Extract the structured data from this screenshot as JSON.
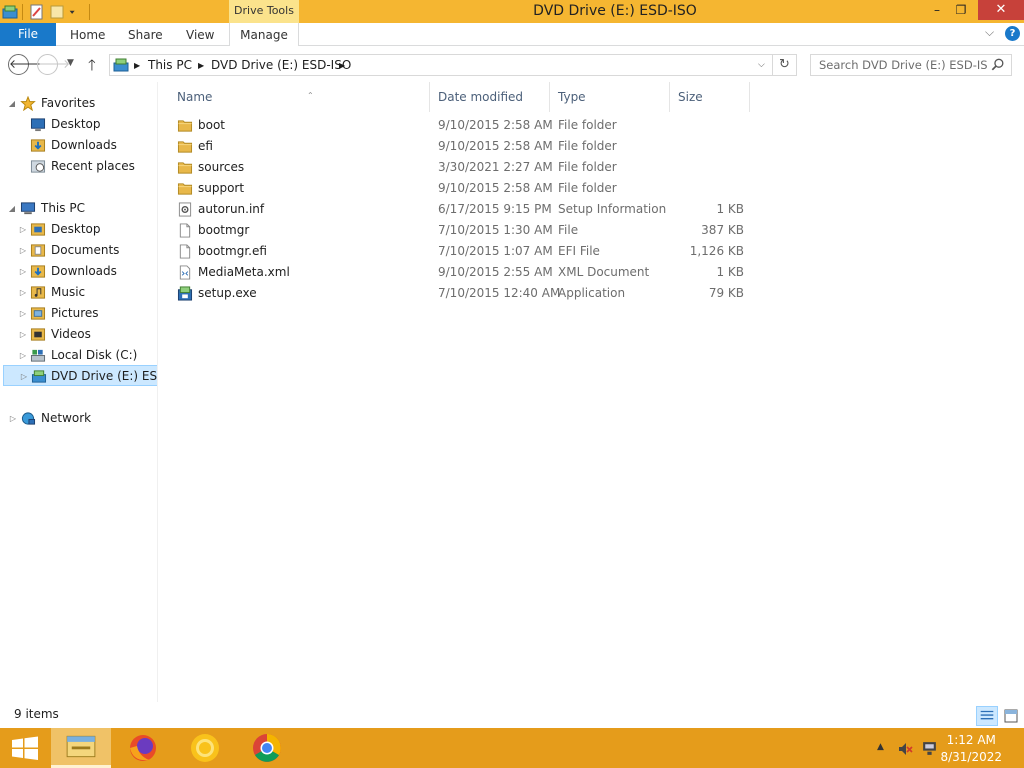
{
  "window": {
    "title": "DVD Drive (E:) ESD-ISO",
    "context_tab_group": "Drive Tools",
    "controls": {
      "minimize": "–",
      "maximize": "❐",
      "close": "✕"
    }
  },
  "ribbon": {
    "tabs": [
      {
        "label": "File",
        "active": true
      },
      {
        "label": "Home"
      },
      {
        "label": "Share"
      },
      {
        "label": "View"
      },
      {
        "label": "Manage"
      }
    ],
    "help": "?"
  },
  "address": {
    "breadcrumb": [
      "This PC",
      "DVD Drive (E:) ESD-ISO"
    ],
    "search_placeholder": "Search DVD Drive (E:) ESD-ISO"
  },
  "nav": {
    "favorites_label": "Favorites",
    "favorites": [
      "Desktop",
      "Downloads",
      "Recent places"
    ],
    "this_pc_label": "This PC",
    "this_pc": [
      "Desktop",
      "Documents",
      "Downloads",
      "Music",
      "Pictures",
      "Videos",
      "Local Disk (C:)",
      "DVD Drive (E:) ESD-ISO"
    ],
    "network_label": "Network"
  },
  "columns": {
    "name": "Name",
    "date": "Date modified",
    "type": "Type",
    "size": "Size"
  },
  "files": [
    {
      "name": "boot",
      "date": "9/10/2015 2:58 AM",
      "type": "File folder",
      "size": "",
      "icon": "folder-icon"
    },
    {
      "name": "efi",
      "date": "9/10/2015 2:58 AM",
      "type": "File folder",
      "size": "",
      "icon": "folder-icon"
    },
    {
      "name": "sources",
      "date": "3/30/2021 2:27 AM",
      "type": "File folder",
      "size": "",
      "icon": "folder-icon"
    },
    {
      "name": "support",
      "date": "9/10/2015 2:58 AM",
      "type": "File folder",
      "size": "",
      "icon": "folder-icon"
    },
    {
      "name": "autorun.inf",
      "date": "6/17/2015 9:15 PM",
      "type": "Setup Information",
      "size": "1 KB",
      "icon": "settings-file-icon"
    },
    {
      "name": "bootmgr",
      "date": "7/10/2015 1:30 AM",
      "type": "File",
      "size": "387 KB",
      "icon": "blank-file-icon"
    },
    {
      "name": "bootmgr.efi",
      "date": "7/10/2015 1:07 AM",
      "type": "EFI File",
      "size": "1,126 KB",
      "icon": "blank-file-icon"
    },
    {
      "name": "MediaMeta.xml",
      "date": "9/10/2015 2:55 AM",
      "type": "XML Document",
      "size": "1 KB",
      "icon": "xml-file-icon"
    },
    {
      "name": "setup.exe",
      "date": "7/10/2015 12:40 AM",
      "type": "Application",
      "size": "79 KB",
      "icon": "setup-app-icon"
    }
  ],
  "status": {
    "items": "9 items"
  },
  "taskbar": {
    "apps": [
      "File Explorer",
      "Firefox",
      "Chrome Canary",
      "Chrome"
    ],
    "time": "1:12 AM",
    "date": "8/31/2022"
  },
  "colors": {
    "title_bar": "#f5b631",
    "taskbar": "#e59c1b",
    "file_tab": "#1979ca",
    "selection": "#cce8ff",
    "folder": "#e8b84a"
  }
}
